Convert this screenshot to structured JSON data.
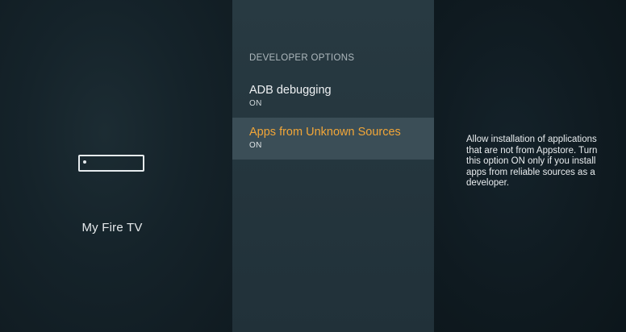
{
  "device": {
    "label": "My Fire TV",
    "icon": "fire-tv-device-icon"
  },
  "developer_options": {
    "header": "DEVELOPER OPTIONS",
    "items": [
      {
        "title": "ADB debugging",
        "status": "ON"
      },
      {
        "title": "Apps from Unknown Sources",
        "status": "ON"
      }
    ]
  },
  "description": "Allow installation of applications that are not from Appstore. Turn this option ON only if you install apps from reliable sources as a developer.",
  "colors": {
    "highlight_text": "#f2a638",
    "selected_row": "#3b4e57",
    "middle_pane": "#26373f",
    "background": "#0f1a20"
  }
}
